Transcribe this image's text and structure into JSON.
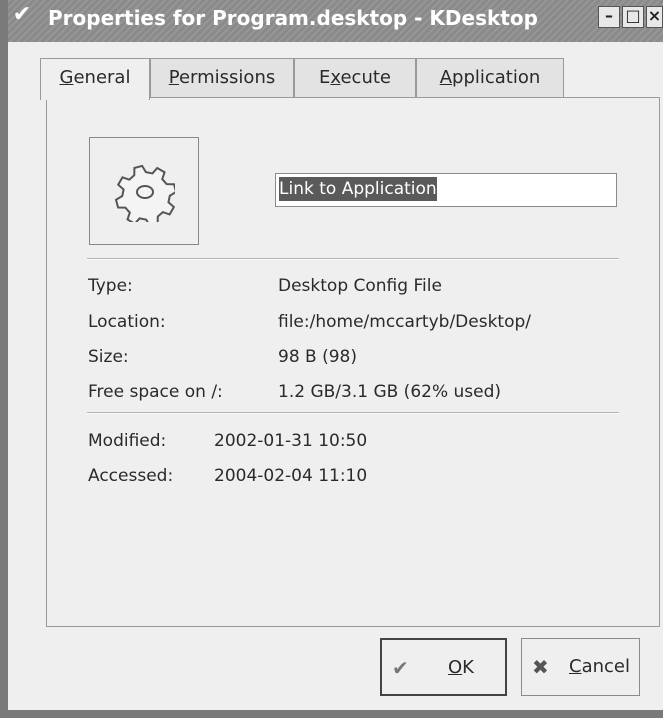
{
  "window": {
    "title": "Properties for Program.desktop - KDesktop",
    "controls": [
      "minimize-icon",
      "maximize-icon",
      "close-icon"
    ]
  },
  "tabs": [
    {
      "label": "General",
      "mnemonic": "G",
      "rest": "eneral"
    },
    {
      "label": "Permissions",
      "mnemonic": "P",
      "rest": "ermissions"
    },
    {
      "label": "Execute",
      "pre": "E",
      "mnemonic": "x",
      "rest": "ecute"
    },
    {
      "label": "Application",
      "mnemonic": "A",
      "rest": "pplication"
    }
  ],
  "general": {
    "icon": "gear-icon",
    "name_value": "Link to Application",
    "info": [
      {
        "label": "Type:",
        "value": "Desktop Config File"
      },
      {
        "label": "Location:",
        "value": "file:/home/mccartyb/Desktop/"
      },
      {
        "label": "Size:",
        "value": "98 B (98)"
      },
      {
        "label": "Free space on /:",
        "value": "1.2 GB/3.1 GB (62% used)"
      }
    ],
    "dates": [
      {
        "label": "Modified:",
        "value": "2002-01-31 10:50"
      },
      {
        "label": "Accessed:",
        "value": "2004-02-04 11:10"
      }
    ]
  },
  "buttons": {
    "ok": {
      "mnemonic": "O",
      "rest": "K",
      "icon": "checkmark-icon"
    },
    "cancel": {
      "mnemonic": "C",
      "rest": "ancel",
      "icon": "cancel-x-icon"
    }
  }
}
